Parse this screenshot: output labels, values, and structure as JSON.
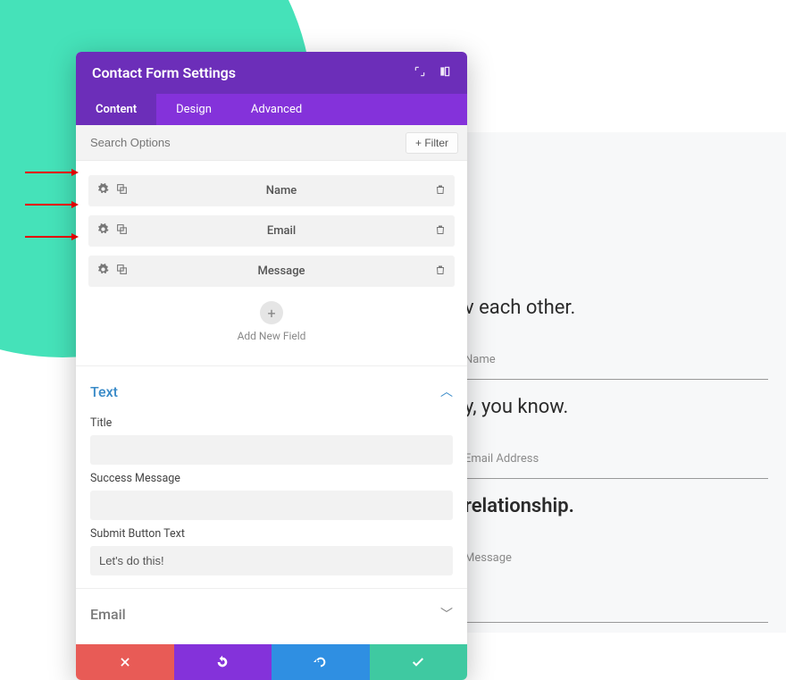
{
  "modal": {
    "title": "Contact Form Settings",
    "tabs": {
      "content": "Content",
      "design": "Design",
      "advanced": "Advanced"
    },
    "search_placeholder": "Search Options",
    "filter_label": "Filter",
    "fields": [
      {
        "label": "Name"
      },
      {
        "label": "Email"
      },
      {
        "label": "Message"
      }
    ],
    "add_new_label": "Add New Field",
    "text_section": {
      "header": "Text",
      "title_label": "Title",
      "title_value": "",
      "success_label": "Success Message",
      "success_value": "",
      "submit_label": "Submit Button Text",
      "submit_value": "Let's do this!"
    },
    "email_section": {
      "header": "Email"
    }
  },
  "preview": {
    "hint1": "v each other.",
    "hint2": "y, you know.",
    "hint3": "relationship.",
    "name": "Name",
    "email": "Email Address",
    "message": "Message"
  }
}
